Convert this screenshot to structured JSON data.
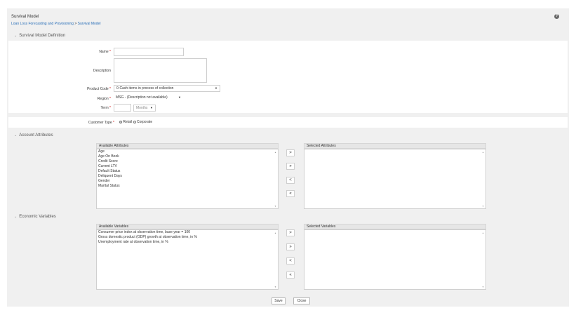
{
  "header": {
    "title": "Survival Model",
    "breadcrumb": {
      "parent": "Loan Loss Forecasting and Provisioning",
      "separator": ">",
      "current": "Survival Model"
    },
    "help_icon": "help-icon"
  },
  "definition": {
    "section_title": "Survival Model Definition",
    "name": {
      "label": "Name",
      "required": "*",
      "value": ""
    },
    "description": {
      "label": "Description",
      "value": ""
    },
    "product_code": {
      "label": "Product Code",
      "required": "*",
      "value": "0-Cash items in process of collection"
    },
    "region": {
      "label": "Region",
      "required": "*",
      "value": "MSG - (Description not available)"
    },
    "term": {
      "label": "Term",
      "required": "*",
      "value": "",
      "unit": "Months"
    },
    "customer_type": {
      "label": "Customer Type",
      "required": "*",
      "options": [
        "Retail",
        "Corporate"
      ],
      "selected": "Retail"
    }
  },
  "account_attributes": {
    "section_title": "Account Attributes",
    "available_header": "Available Attributes",
    "selected_header": "Selected Attributes",
    "available": [
      "Age",
      "Age On Book",
      "Credit Score",
      "Current LTV",
      "Default Status",
      "Deliquent Days",
      "Gender",
      "Marital Status"
    ],
    "selected": []
  },
  "economic_variables": {
    "section_title": "Economic Variables",
    "available_header": "Available Variables",
    "selected_header": "Selected Variables",
    "available": [
      "Consumer price index at observation time, base year = 100",
      "Gross domestic product (GDP) growth at observation time, in %",
      "Unemployment rate at observation time, in %"
    ],
    "selected": []
  },
  "shuttle_buttons": {
    "move_one": ">",
    "move_all": "»",
    "remove_one": "<",
    "remove_all": "«"
  },
  "footer": {
    "save": "Save",
    "close": "Close"
  },
  "colors": {
    "link": "#2a6fb8",
    "required": "#cc0000",
    "background": "#f0f0f0",
    "panel": "#ffffff"
  }
}
